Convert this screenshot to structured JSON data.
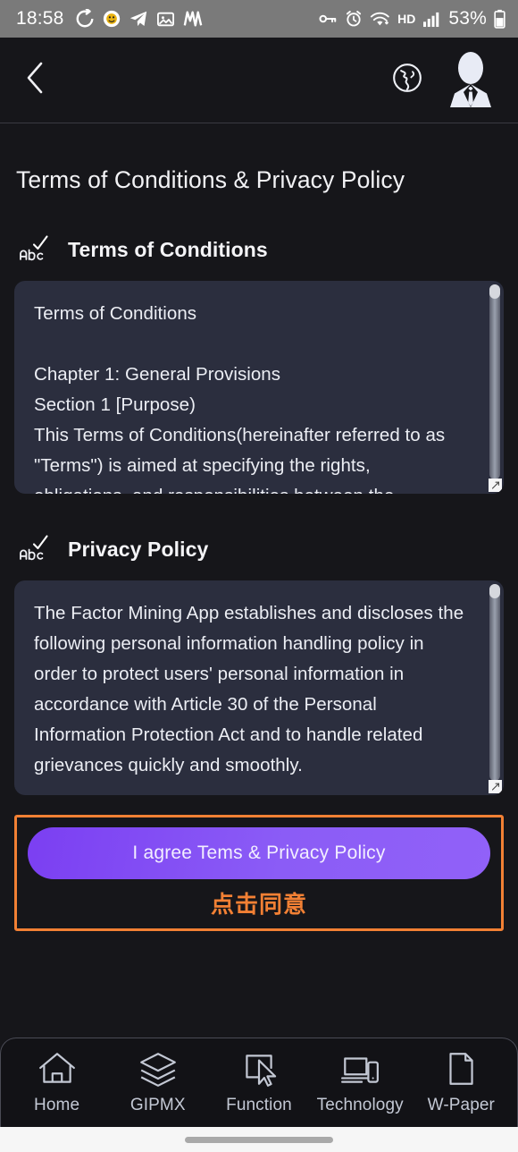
{
  "statusbar": {
    "time": "18:58",
    "left_icons": [
      "go-forward-icon",
      "emoji-app-icon",
      "telegram-icon",
      "photos-icon",
      "app-icon"
    ],
    "right_icons": [
      "vpn-key-icon",
      "alarm-icon",
      "wifi-icon",
      "hd-icon",
      "signal-icon"
    ],
    "hd_label": "HD",
    "battery_percent": "53%",
    "background": "#7a7a7a"
  },
  "appbar": {
    "back_icon": "chevron-left-icon",
    "language_icon": "globe-icon",
    "avatar_icon": "user-avatar-icon"
  },
  "page": {
    "title": "Terms of Conditions & Privacy Policy"
  },
  "terms_section": {
    "icon": "spellcheck-abc-icon",
    "label": "Terms of Conditions",
    "body": "Terms of Conditions\n\nChapter 1: General Provisions\nSection 1 [Purpose)\nThis Terms of Conditions(hereinafter referred to as \"Terms\") is aimed at specifying the rights, obligations, and responsibilities between the"
  },
  "privacy_section": {
    "icon": "spellcheck-abc-icon",
    "label": "Privacy Policy",
    "body": "The Factor Mining App establishes and discloses the following personal information handling policy in order to protect users' personal information in accordance with Article 30 of the Personal Information Protection Act and to handle related grievances quickly and smoothly."
  },
  "agree": {
    "button_label": "I agree Tems & Privacy Policy",
    "annotation": "点击同意",
    "highlight_color": "#f28034",
    "button_color": "#8b5cf6"
  },
  "bottomnav": {
    "items": [
      {
        "label": "Home",
        "icon": "home-icon"
      },
      {
        "label": "GIPMX",
        "icon": "layers-icon"
      },
      {
        "label": "Function",
        "icon": "cursor-select-icon"
      },
      {
        "label": "Technology",
        "icon": "devices-icon"
      },
      {
        "label": "W-Paper",
        "icon": "document-icon"
      }
    ]
  }
}
